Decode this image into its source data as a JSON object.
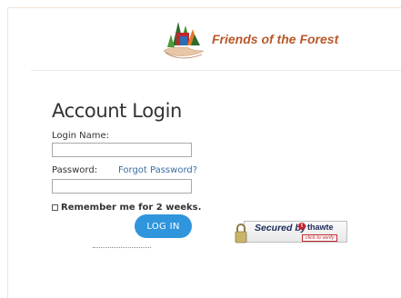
{
  "header": {
    "brand_name": "Friends of the Forest"
  },
  "login": {
    "title": "Account Login",
    "login_name_label": "Login Name:",
    "password_label": "Password:",
    "forgot_password": "Forgot Password?",
    "remember_label": "Remember me for 2 weeks.",
    "login_button": "LOG IN",
    "login_name_value": "",
    "password_value": ""
  },
  "seal": {
    "secured_by": "Secured by",
    "brand": "thawte",
    "click_to_verify": "click to verify",
    "icon": "padlock-icon"
  },
  "colors": {
    "brand": "#b8582a",
    "button": "#2f95dc",
    "link": "#3a6e9f"
  }
}
